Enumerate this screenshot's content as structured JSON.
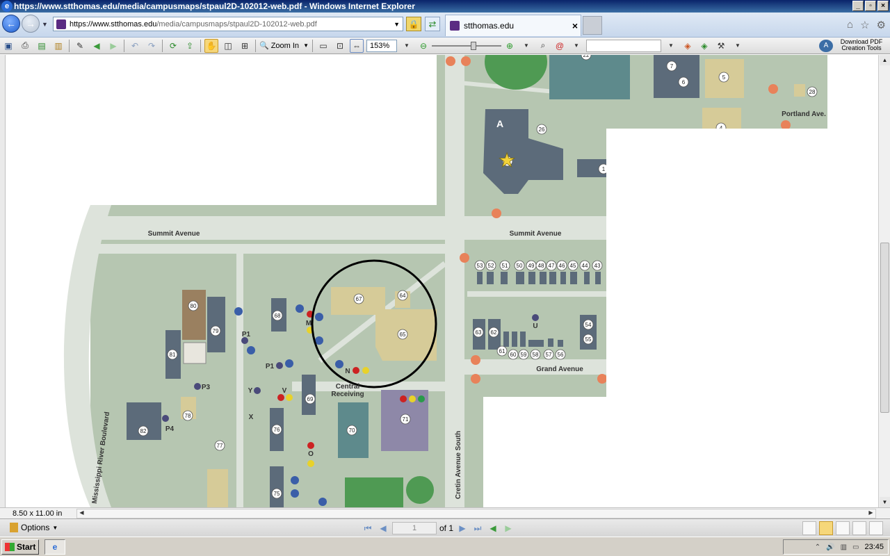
{
  "window": {
    "title": "https://www.stthomas.edu/media/campusmaps/stpaul2D-102012-web.pdf - Windows Internet Explorer",
    "minimize": "_",
    "maximize": "▫",
    "close": "×"
  },
  "nav": {
    "address_prefix": "https://www.",
    "address_domain": "stthomas.edu",
    "address_path": "/media/campusmaps/stpaul2D-102012-web.pdf",
    "tab_label": "stthomas.edu",
    "tab_close": "×"
  },
  "toolbar": {
    "zoom_label": "Zoom In",
    "zoom_value": "153%",
    "zoom_level_percent": 153,
    "download_pdf_line1": "Download PDF",
    "download_pdf_line2": "Creation Tools"
  },
  "map": {
    "streets": [
      "Summit Avenue",
      "Summit Avenue",
      "Grand Avenue",
      "Portland Ave.",
      "Cretin Avenue South",
      "Mississippi River Boulevard"
    ],
    "central_receiving": [
      "Central",
      "Receiving"
    ],
    "buildings": [
      "22",
      "7",
      "6",
      "5",
      "28",
      "4",
      "26",
      "27",
      "1",
      "53",
      "52",
      "51",
      "50",
      "49",
      "48",
      "47",
      "46",
      "45",
      "44",
      "43",
      "67",
      "64",
      "65",
      "68",
      "80",
      "79",
      "81",
      "78",
      "82",
      "77",
      "76",
      "75",
      "69",
      "70",
      "71",
      "63",
      "62",
      "61",
      "60",
      "59",
      "58",
      "57",
      "56",
      "54",
      "55"
    ],
    "lot_letters": [
      "A",
      "M",
      "P1",
      "P1",
      "P3",
      "P4",
      "N",
      "V",
      "Y",
      "X",
      "O",
      "U"
    ],
    "marked_area": "buildings 64, 65, 67"
  },
  "status": {
    "page_size": "8.50 x 11.00 in"
  },
  "bottom": {
    "options_label": "Options",
    "page_current": "1",
    "page_of": "of 1"
  },
  "taskbar": {
    "start_label": "Start",
    "clock": "23:45"
  }
}
